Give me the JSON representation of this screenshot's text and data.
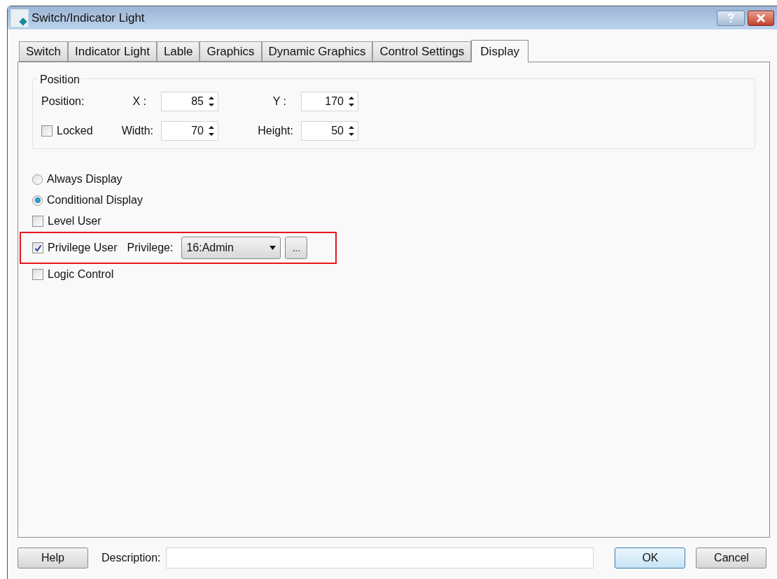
{
  "window": {
    "title": "Switch/Indicator Light"
  },
  "tabs": [
    {
      "label": "Switch",
      "selected": false
    },
    {
      "label": "Indicator Light",
      "selected": false
    },
    {
      "label": "Lable",
      "selected": false
    },
    {
      "label": "Graphics",
      "selected": false
    },
    {
      "label": "Dynamic Graphics",
      "selected": false
    },
    {
      "label": "Control Settings",
      "selected": false
    },
    {
      "label": "Display",
      "selected": true
    }
  ],
  "position_group": {
    "title": "Position",
    "row_label": "Position:",
    "locked": {
      "label": "Locked",
      "checked": false
    },
    "fields": [
      {
        "label": "X :",
        "value": "85"
      },
      {
        "label": "Y :",
        "value": "170"
      },
      {
        "label": "Width:",
        "value": "70"
      },
      {
        "label": "Height:",
        "value": "50"
      }
    ]
  },
  "display_options": [
    {
      "kind": "radio",
      "label": "Always Display",
      "selected": false
    },
    {
      "kind": "radio",
      "label": "Conditional Display",
      "selected": true
    },
    {
      "kind": "checkbox",
      "label": "Level User",
      "checked": false
    },
    {
      "kind": "checkbox",
      "label": "Privilege User",
      "checked": true,
      "highlighted": true,
      "privilege": {
        "label": "Privilege:",
        "value": "16:Admin",
        "browse": "..."
      }
    },
    {
      "kind": "checkbox",
      "label": "Logic Control",
      "checked": false
    }
  ],
  "footer": {
    "help": "Help",
    "description_label": "Description:",
    "ok": "OK",
    "cancel": "Cancel"
  }
}
